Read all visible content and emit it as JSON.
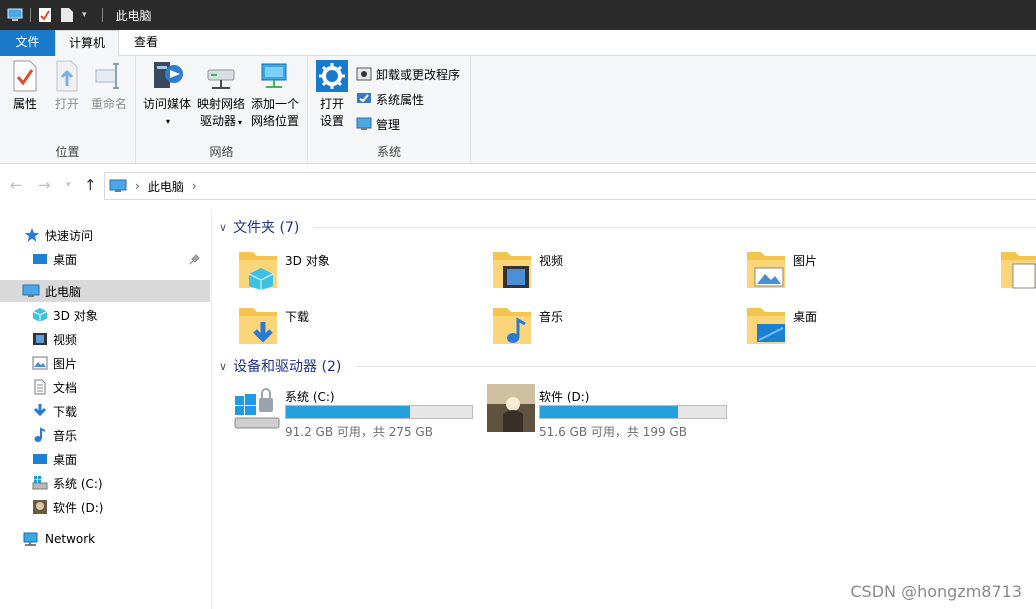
{
  "window": {
    "title": "此电脑"
  },
  "ribbon_tabs": [
    "文件",
    "计算机",
    "查看"
  ],
  "ribbon": {
    "groups": {
      "location": "位置",
      "network": "网络",
      "system": "系统"
    },
    "buttons": {
      "properties": "属性",
      "open": "打开",
      "rename": "重命名",
      "access_media": "访问媒体",
      "map_drive_line1": "映射网络",
      "map_drive_line2": "驱动器",
      "add_location_line1": "添加一个",
      "add_location_line2": "网络位置",
      "open_settings_line1": "打开",
      "open_settings_line2": "设置",
      "uninstall": "卸载或更改程序",
      "system_properties": "系统属性",
      "manage": "管理"
    }
  },
  "address": {
    "crumb": "此电脑"
  },
  "sidebar": {
    "items": [
      {
        "label": "快速访问",
        "icon": "star-icon"
      },
      {
        "label": "桌面",
        "icon": "desktop-icon"
      },
      {
        "label": "此电脑",
        "icon": "computer-icon"
      },
      {
        "label": "3D 对象",
        "icon": "cube-icon"
      },
      {
        "label": "视频",
        "icon": "video-icon"
      },
      {
        "label": "图片",
        "icon": "picture-icon"
      },
      {
        "label": "文档",
        "icon": "document-icon"
      },
      {
        "label": "下载",
        "icon": "download-icon"
      },
      {
        "label": "音乐",
        "icon": "music-icon"
      },
      {
        "label": "桌面",
        "icon": "desktop-icon"
      },
      {
        "label": "系统 (C:)",
        "icon": "drive-c-icon"
      },
      {
        "label": "软件 (D:)",
        "icon": "drive-d-icon"
      },
      {
        "label": "Network",
        "icon": "network-icon"
      }
    ]
  },
  "folders": {
    "header": "文件夹 (7)",
    "items": [
      {
        "label": "3D 对象"
      },
      {
        "label": "视频"
      },
      {
        "label": "图片"
      },
      {
        "label": ""
      },
      {
        "label": "下载"
      },
      {
        "label": "音乐"
      },
      {
        "label": "桌面"
      }
    ]
  },
  "drives": {
    "header": "设备和驱动器 (2)",
    "items": [
      {
        "name": "系统 (C:)",
        "info": "91.2 GB 可用，共 275 GB",
        "used_fraction": 0.668
      },
      {
        "name": "软件 (D:)",
        "info": "51.6 GB 可用，共 199 GB",
        "used_fraction": 0.741
      }
    ]
  },
  "watermark": "CSDN @hongzm8713",
  "colors": {
    "accent": "#1979ca",
    "usage_bar": "#26a0da",
    "section_header": "#1e3287",
    "folder": "#f4c44e"
  }
}
